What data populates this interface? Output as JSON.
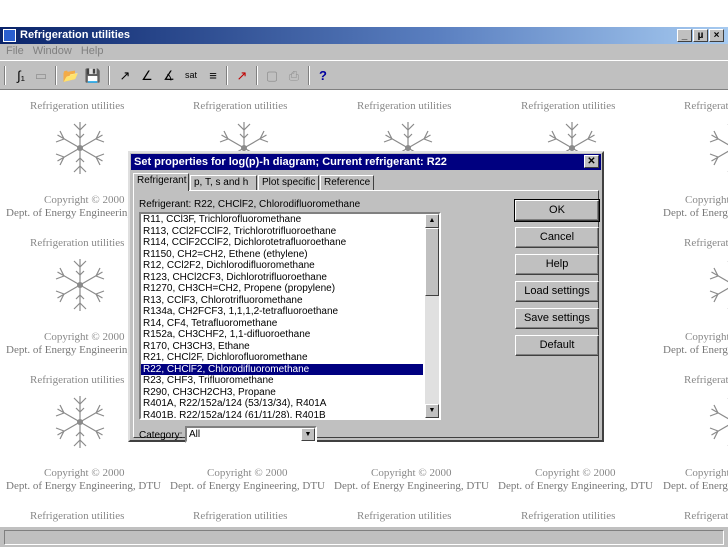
{
  "window": {
    "title": "Refrigeration utilities",
    "buttons": [
      "_",
      "µ",
      "×"
    ]
  },
  "menu": [
    "File",
    "Window",
    "Help"
  ],
  "toolbar": [
    {
      "icon": "diagram-icon",
      "glyph": "∫₁"
    },
    {
      "icon": "open-icon",
      "glyph": "📂"
    },
    {
      "icon": "save-icon",
      "glyph": "💾"
    },
    {
      "icon": "log-ph-icon",
      "glyph": "↗"
    },
    {
      "icon": "ts-icon",
      "glyph": "∠"
    },
    {
      "icon": "hs-icon",
      "glyph": "∡"
    },
    {
      "icon": "sat-icon",
      "glyph": "sat"
    },
    {
      "icon": "table-icon",
      "glyph": "≡"
    },
    {
      "icon": "chart-icon",
      "glyph": "↗"
    },
    {
      "icon": "copy-icon",
      "glyph": "▢"
    },
    {
      "icon": "print-icon",
      "glyph": "⎙"
    },
    {
      "icon": "help-icon",
      "glyph": "?"
    }
  ],
  "watermark": {
    "caption": "Refrigeration utilities",
    "copyright": "Copyright © 2000",
    "dept": "Dept. of Energy Engineering, DTU"
  },
  "dialog": {
    "title": "Set properties for log(p)-h diagram; Current refrigerant: R22",
    "tabs": [
      "Refrigerant",
      "p, T, s and h",
      "Plot specific",
      "Reference"
    ],
    "refrigerant_prefix": "Refrigerant:",
    "refrigerant_value": "R22, CHClF2, Chlorodifluoromethane",
    "list": [
      "R11, CCl3F, Trichlorofluoromethane",
      "R113, CCl2FCClF2, Trichlorotrifluoroethane",
      "R114, CClF2CClF2, Dichlorotetrafluoroethane",
      "R1150, CH2=CH2, Ethene (ethylene)",
      "R12, CCl2F2, Dichlorodifluoromethane",
      "R123, CHCl2CF3, Dichlorotrifluoroethane",
      "R1270, CH3CH=CH2, Propene (propylene)",
      "R13, CClF3, Chlorotrifluoromethane",
      "R134a, CH2FCF3, 1,1,1,2-tetrafluoroethane",
      "R14, CF4, Tetrafluoromethane",
      "R152a, CH3CHF2, 1,1-difluoroethane",
      "R170, CH3CH3, Ethane",
      "R21, CHCl2F, Dichlorofluoromethane",
      "R22, CHClF2, Chlorodifluoromethane",
      "R23, CHF3, Trifluoromethane",
      "R290, CH3CH2CH3, Propane",
      "R401A, R22/152a/124 (53/13/34), R401A",
      "R401B, R22/152a/124 (61/11/28), R401B"
    ],
    "selected_index": 13,
    "category_label": "Category:",
    "category_value": "All",
    "buttons": [
      "OK",
      "Cancel",
      "Help",
      "Load settings",
      "Save settings",
      "Default"
    ]
  }
}
